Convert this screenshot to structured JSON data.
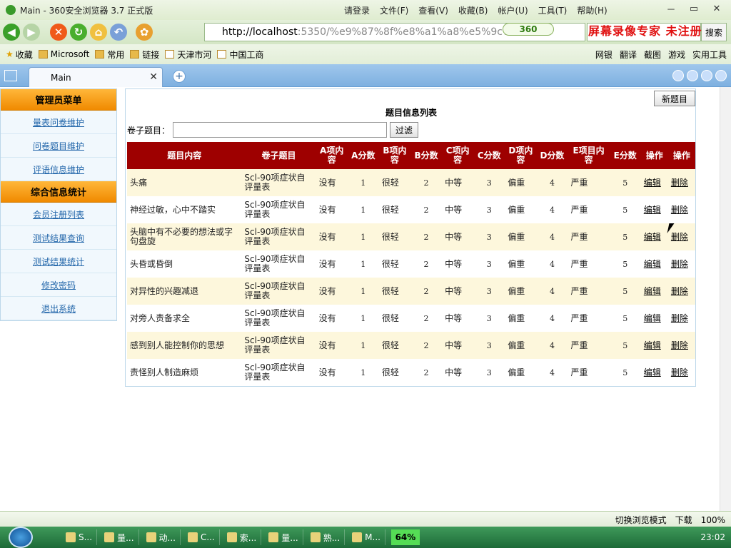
{
  "window": {
    "title": "Main - 360安全浏览器 3.7 正式版",
    "menu": [
      "请登录",
      "文件(F)",
      "查看(V)",
      "收藏(B)",
      "帐户(U)",
      "工具(T)",
      "帮助(H)"
    ],
    "controls": [
      "－",
      "▭",
      "✕"
    ]
  },
  "navbar": {
    "url_host": "http://localhost",
    "url_rest": ":5350/%e9%87%8f%e8%a1%a8%e5%9c%a8",
    "badge": "360",
    "watermark": "屏幕录像专家  未注册",
    "search_button": "搜索"
  },
  "favbar": {
    "items": [
      "收藏",
      "Microsoft",
      "常用",
      "链接",
      "天津市河",
      "中国工商"
    ],
    "tools": [
      "网银",
      "翻译",
      "截图",
      "游戏",
      "实用工具"
    ]
  },
  "tabs": {
    "active": "Main"
  },
  "sidebar": {
    "groups": [
      {
        "title": "管理员菜单",
        "items": [
          "量表问卷维护",
          "问卷题目维护",
          "评语信息维护"
        ]
      },
      {
        "title": "综合信息统计",
        "items": [
          "会员注册列表",
          "测试结果查询",
          "测试结果统计",
          "修改密码",
          "退出系统"
        ]
      }
    ]
  },
  "main": {
    "new_button": "新题目",
    "title": "题目信息列表",
    "filter_label": "卷子题目：",
    "filter_value": "",
    "filter_button": "过滤",
    "columns": [
      "题目内容",
      "卷子题目",
      "A项内容",
      "A分数",
      "B项内容",
      "B分数",
      "C项内容",
      "C分数",
      "D项内容",
      "D分数",
      "E项目内容",
      "E分数",
      "操作",
      "操作"
    ],
    "rows": [
      [
        "头痛",
        "Scl-90项症状自评量表",
        "没有",
        "1",
        "很轻",
        "2",
        "中等",
        "3",
        "偏重",
        "4",
        "严重",
        "5",
        "编辑",
        "删除"
      ],
      [
        "神经过敏，心中不踏实",
        "Scl-90项症状自评量表",
        "没有",
        "1",
        "很轻",
        "2",
        "中等",
        "3",
        "偏重",
        "4",
        "严重",
        "5",
        "编辑",
        "删除"
      ],
      [
        "头脑中有不必要的想法或字句盘旋",
        "Scl-90项症状自评量表",
        "没有",
        "1",
        "很轻",
        "2",
        "中等",
        "3",
        "偏重",
        "4",
        "严重",
        "5",
        "编辑",
        "删除"
      ],
      [
        "头昏或昏倒",
        "Scl-90项症状自评量表",
        "没有",
        "1",
        "很轻",
        "2",
        "中等",
        "3",
        "偏重",
        "4",
        "严重",
        "5",
        "编辑",
        "删除"
      ],
      [
        "对异性的兴趣减退",
        "Scl-90项症状自评量表",
        "没有",
        "1",
        "很轻",
        "2",
        "中等",
        "3",
        "偏重",
        "4",
        "严重",
        "5",
        "编辑",
        "删除"
      ],
      [
        "对旁人责备求全",
        "Scl-90项症状自评量表",
        "没有",
        "1",
        "很轻",
        "2",
        "中等",
        "3",
        "偏重",
        "4",
        "严重",
        "5",
        "编辑",
        "删除"
      ],
      [
        "感到别人能控制你的思想",
        "Scl-90项症状自评量表",
        "没有",
        "1",
        "很轻",
        "2",
        "中等",
        "3",
        "偏重",
        "4",
        "严重",
        "5",
        "编辑",
        "删除"
      ],
      [
        "责怪别人制造麻烦",
        "Scl-90项症状自评量表",
        "没有",
        "1",
        "很轻",
        "2",
        "中等",
        "3",
        "偏重",
        "4",
        "严重",
        "5",
        "编辑",
        "删除"
      ]
    ]
  },
  "statusbar": {
    "mode": "切换浏览模式",
    "download": "下载",
    "zoom": "100%"
  },
  "taskbar": {
    "items": [
      "S...",
      "量...",
      "动...",
      "C...",
      "索...",
      "量...",
      "熟...",
      "M..."
    ],
    "cpu": "64%",
    "clock": "23:02"
  },
  "colors": {
    "header_red": "#9e0000",
    "menu_orange": "#f08a00",
    "row_alt": "#fdf7dc"
  }
}
